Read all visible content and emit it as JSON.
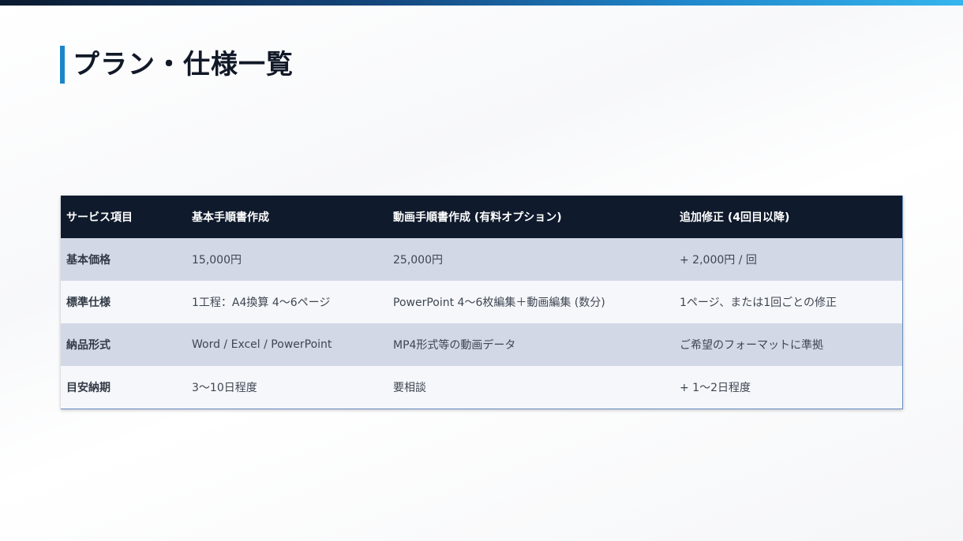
{
  "page": {
    "title": "プラン・仕様一覧"
  },
  "table": {
    "headers": [
      "サービス項目",
      "基本手順書作成",
      "動画手順書作成 (有料オプション)",
      "追加修正 (4回目以降)"
    ],
    "rows": [
      {
        "label": "基本価格",
        "cells": [
          "15,000円",
          "25,000円",
          "+ 2,000円 / 回"
        ]
      },
      {
        "label": "標準仕様",
        "cells": [
          "1工程：A4換算 4〜6ページ",
          "PowerPoint 4〜6枚編集＋動画編集 (数分)",
          "1ページ、または1回ごとの修正"
        ]
      },
      {
        "label": "納品形式",
        "cells": [
          "Word / Excel / PowerPoint",
          "MP4形式等の動画データ",
          "ご希望のフォーマットに準拠"
        ]
      },
      {
        "label": "目安納期",
        "cells": [
          "3〜10日程度",
          "要相談",
          "+ 1〜2日程度"
        ]
      }
    ]
  },
  "colors": {
    "header_bg": "#0f1a2c",
    "accent": "#1a86c8",
    "row_odd": "#d2d8e6",
    "row_even": "#f5f7fa"
  }
}
